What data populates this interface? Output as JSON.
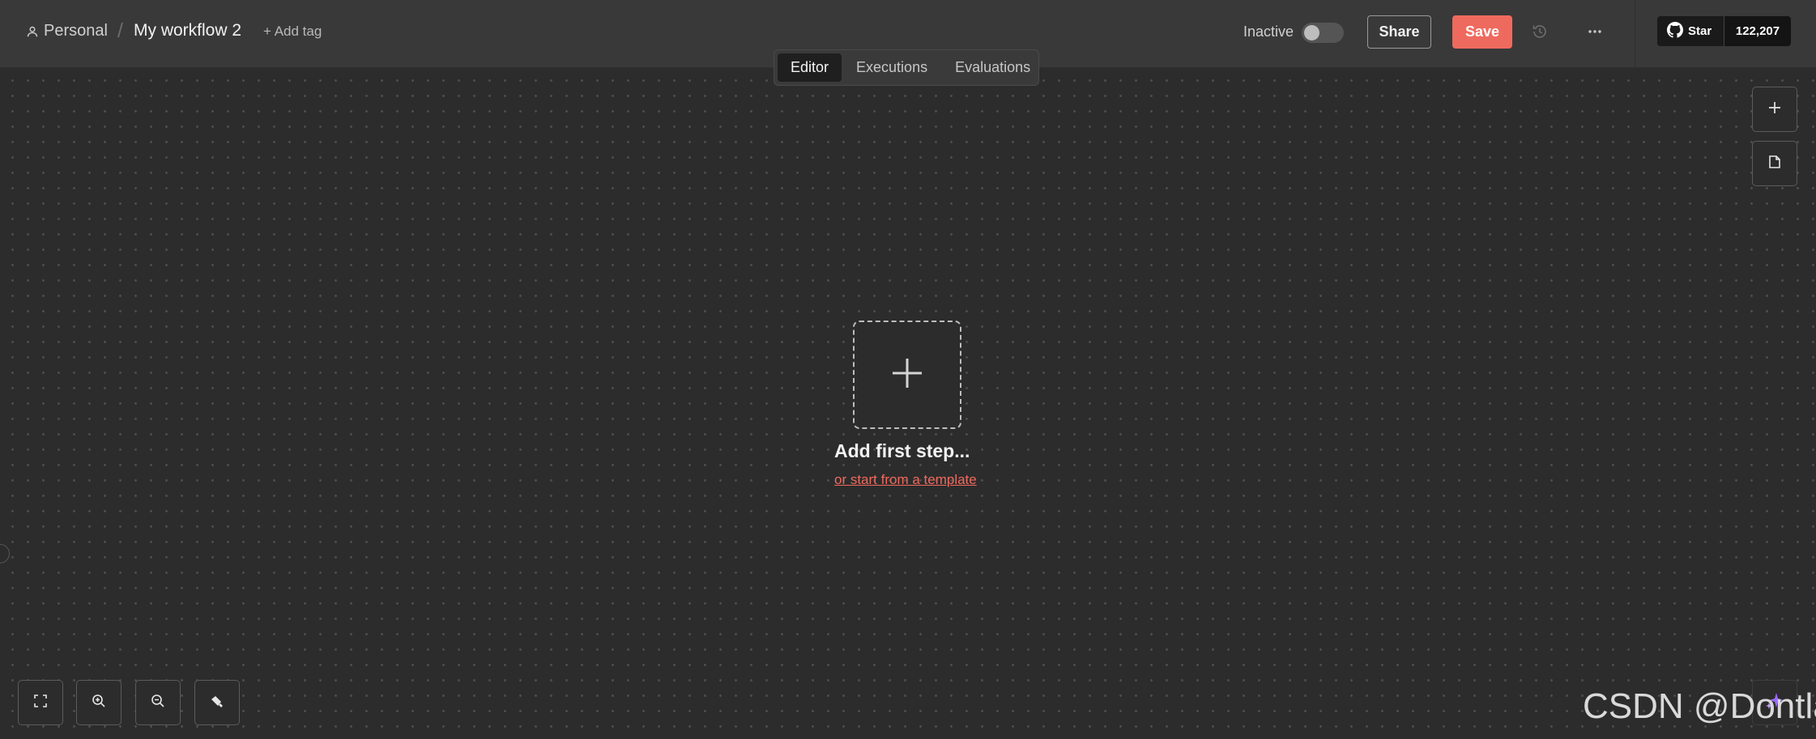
{
  "header": {
    "project_label": "Personal",
    "separator": "/",
    "workflow_name": "My workflow 2",
    "add_tag_label": "+ Add tag",
    "status_label": "Inactive",
    "share_label": "Share",
    "save_label": "Save",
    "github": {
      "star_label": "Star",
      "star_count": "122,207"
    }
  },
  "tabs": [
    {
      "label": "Editor",
      "active": true
    },
    {
      "label": "Executions",
      "active": false
    },
    {
      "label": "Evaluations",
      "active": false
    }
  ],
  "canvas": {
    "add_first_step_label": "Add first step...",
    "template_link_label": "or start from a template"
  },
  "watermark": "CSDN @Dontla",
  "icons": {
    "person": "person-icon",
    "history": "history-icon",
    "more": "more-dots-icon",
    "github": "github-icon",
    "plus": "plus-icon",
    "sticky_note": "sticky-note-icon",
    "fit_view": "fit-view-icon",
    "zoom_in": "zoom-in-icon",
    "zoom_out": "zoom-out-icon",
    "tidy_up": "tidy-up-icon",
    "ai_assistant": "sparkle-icon"
  },
  "colors": {
    "accent": "#ef6a5e",
    "topbar_bg": "#393939",
    "canvas_bg": "#2c2c2c"
  }
}
